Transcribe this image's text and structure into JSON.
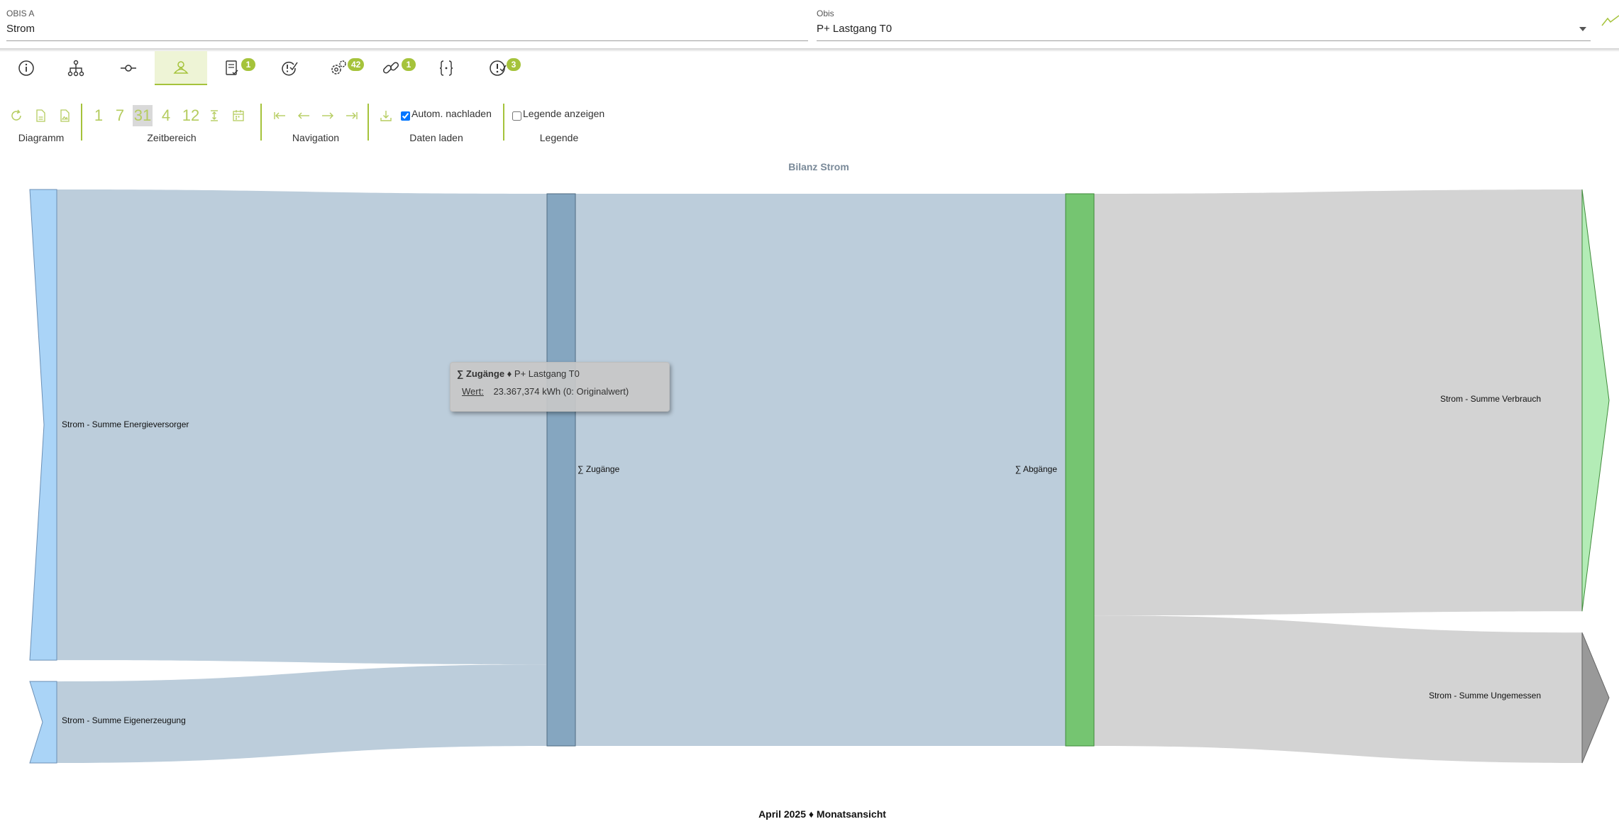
{
  "header": {
    "obis_a_label": "OBIS A",
    "obis_a_value": "Strom",
    "obis_label": "Obis",
    "obis_value": "P+ Lastgang T0"
  },
  "tabs": [
    {
      "name": "info",
      "icon": "info-icon",
      "badge": ""
    },
    {
      "name": "hierarchy",
      "icon": "hierarchy-icon",
      "badge": ""
    },
    {
      "name": "meter-point",
      "icon": "commit-node-icon",
      "badge": ""
    },
    {
      "name": "energy-balance",
      "icon": "energy-balance-icon",
      "badge": "",
      "active": true
    },
    {
      "name": "documents",
      "icon": "document-check-icon",
      "badge": "1"
    },
    {
      "name": "validation",
      "icon": "alert-check-icon",
      "badge": ""
    },
    {
      "name": "settings",
      "icon": "gears-icon",
      "badge": "42"
    },
    {
      "name": "links",
      "icon": "link-icon",
      "badge": "1"
    },
    {
      "name": "formula",
      "icon": "braces-icon",
      "badge": ""
    },
    {
      "name": "alerts",
      "icon": "alert-clock-icon",
      "badge": "3"
    }
  ],
  "toolbar": {
    "groups": {
      "diagramm": "Diagramm",
      "zeitbereich": "Zeitbereich",
      "navigation": "Navigation",
      "daten_laden": "Daten laden",
      "legende": "Legende"
    },
    "ranges": [
      "1",
      "7",
      "31",
      "4",
      "12"
    ],
    "active_range": "31",
    "auto_reload_label": "Autom. nachladen",
    "auto_reload_checked": true,
    "show_legend_label": "Legende anzeigen",
    "show_legend_checked": false
  },
  "tooltip": {
    "title": "∑ Zugänge",
    "subtitle": "♦ P+ Lastgang T0",
    "key": "Wert:",
    "value": "23.367,374 kWh (0: Originalwert)"
  },
  "colors": {
    "accent": "#a5c33b",
    "link_blue": "#bccddb",
    "link_grey": "#d3d3d3",
    "node_supplier": "#aad4f7",
    "node_inflow": "#85a6c0",
    "node_outflow": "#75c571",
    "node_consumption": "#b3ecb6",
    "node_unmetered": "#999999"
  },
  "chart_data": {
    "type": "sankey",
    "title": "Bilanz Strom",
    "caption": "April 2025 ♦ Monatsansicht",
    "nodes": [
      {
        "id": "supplier",
        "label": "Strom - Summe Energieversorger"
      },
      {
        "id": "own",
        "label": "Strom - Summe Eigenerzeugung"
      },
      {
        "id": "in",
        "label": "∑ Zugänge"
      },
      {
        "id": "out",
        "label": "∑ Abgänge"
      },
      {
        "id": "consumption",
        "label": "Strom - Summe Verbrauch"
      },
      {
        "id": "unmetered",
        "label": "Strom - Summe Ungemessen"
      }
    ],
    "links": [
      {
        "source": "supplier",
        "target": "in",
        "value": 19916
      },
      {
        "source": "own",
        "target": "in",
        "value": 3451
      },
      {
        "source": "in",
        "target": "out",
        "value": 23367
      },
      {
        "source": "out",
        "target": "consumption",
        "value": 17849
      },
      {
        "source": "out",
        "target": "unmetered",
        "value": 5518
      }
    ],
    "total_inflow_kwh": 23367.374
  }
}
